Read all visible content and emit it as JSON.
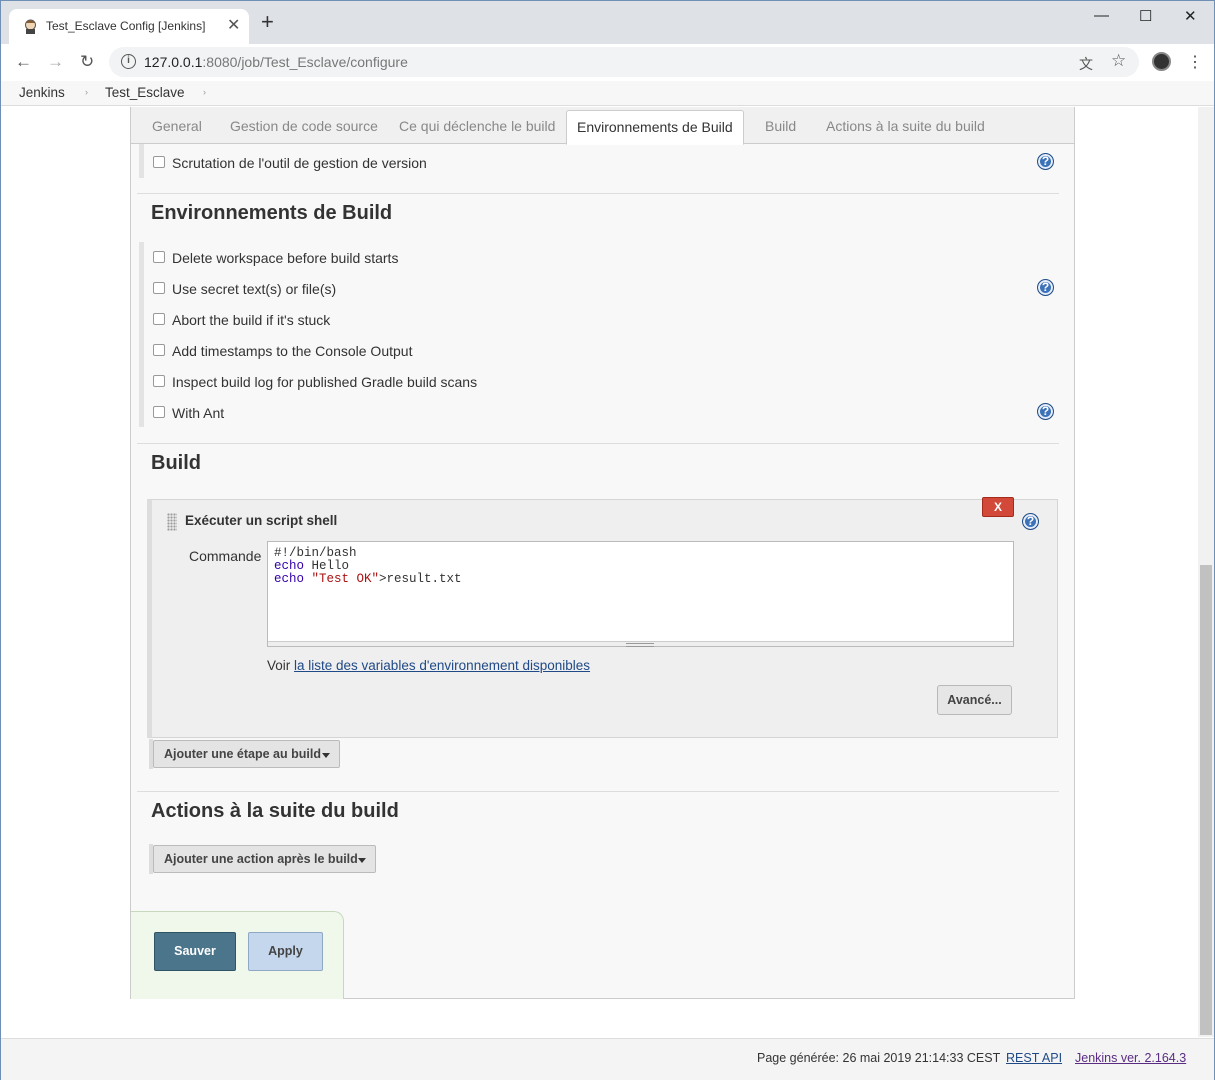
{
  "browser": {
    "tab_title": "Test_Esclave Config [Jenkins]",
    "tab_close": "✕",
    "new_tab": "+",
    "url_host": "127.0.0.1",
    "url_rest": ":8080/job/Test_Esclave/configure",
    "info_icon": "i",
    "back_icon": "←",
    "forward_icon": "→",
    "reload_icon": "↻",
    "translate_icon": "文",
    "star_icon": "☆",
    "menu_icon": "⋮",
    "minimize_icon": "—",
    "maximize_icon": "☐",
    "close_icon": "✕"
  },
  "breadcrumb": {
    "items": [
      "Jenkins",
      "Test_Esclave"
    ],
    "separator": "›"
  },
  "tabs": [
    {
      "label": "General",
      "active": false
    },
    {
      "label": "Gestion de code source",
      "active": false
    },
    {
      "label": "Ce qui déclenche le build",
      "active": false
    },
    {
      "label": "Environnements de Build",
      "active": true
    },
    {
      "label": "Build",
      "active": false
    },
    {
      "label": "Actions à la suite du build",
      "active": false
    }
  ],
  "triggers": {
    "scm_polling": "Scrutation de l'outil de gestion de version"
  },
  "build_env": {
    "title": "Environnements de Build",
    "options": [
      "Delete workspace before build starts",
      "Use secret text(s) or file(s)",
      "Abort the build if it's stuck",
      "Add timestamps to the Console Output",
      "Inspect build log for published Gradle build scans",
      "With Ant"
    ]
  },
  "build": {
    "title": "Build",
    "step_title": "Exécuter un script shell",
    "delete_label": "X",
    "command_label": "Commande",
    "script_lines": [
      {
        "parts": [
          {
            "t": "#!/bin/bash",
            "c": ""
          }
        ]
      },
      {
        "parts": [
          {
            "t": "echo",
            "c": "kw"
          },
          {
            "t": " Hello",
            "c": ""
          }
        ]
      },
      {
        "parts": [
          {
            "t": "echo",
            "c": "kw"
          },
          {
            "t": " ",
            "c": ""
          },
          {
            "t": "\"Test OK\"",
            "c": "str"
          },
          {
            "t": ">result.txt",
            "c": ""
          }
        ]
      }
    ],
    "env_prefix": "Voir ",
    "env_link": "la liste des variables d'environnement disponibles",
    "advanced_label": "Avancé...",
    "add_step_label": "Ajouter une étape au build"
  },
  "post_build": {
    "title": "Actions à la suite du build",
    "add_action_label": "Ajouter une action après le build"
  },
  "actions": {
    "save_label": "Sauver",
    "apply_label": "Apply"
  },
  "footer": {
    "generated": "Page générée: 26 mai 2019 21:14:33 CEST",
    "rest_api": "REST API",
    "version": "Jenkins ver. 2.164.3"
  },
  "help_icon": "?",
  "colors": {
    "link": "#204a87",
    "version_link": "#5a2d82",
    "save_button": "#4b758b",
    "apply_button": "#c5d7ec",
    "delete_button": "#d24939",
    "help_icon": "#3c73b8"
  }
}
